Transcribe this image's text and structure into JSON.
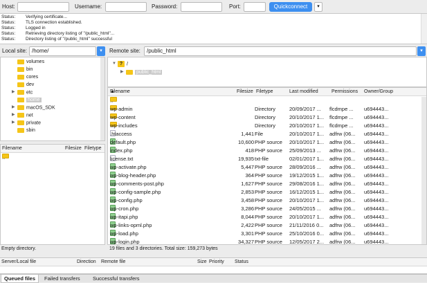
{
  "quickconnect": {
    "host_label": "Host:",
    "username_label": "Username:",
    "password_label": "Password:",
    "port_label": "Port:",
    "connect_label": "Quickconnect",
    "dropdown_glyph": "▾"
  },
  "log": [
    {
      "k": "Status:",
      "v": "Verifying certificate..."
    },
    {
      "k": "Status:",
      "v": "TLS connection established."
    },
    {
      "k": "Status:",
      "v": "Logged in"
    },
    {
      "k": "Status:",
      "v": "Retrieving directory listing of \"/public_html\"..."
    },
    {
      "k": "Status:",
      "v": "Directory listing of \"/public_html\" successful"
    }
  ],
  "local_site": {
    "label": "Local site:",
    "value": "/home/"
  },
  "remote_site": {
    "label": "Remote site:",
    "value": "/public_html"
  },
  "local_tree": [
    {
      "name": "volumes",
      "arrow": ""
    },
    {
      "name": "bin",
      "arrow": ""
    },
    {
      "name": "cores",
      "arrow": ""
    },
    {
      "name": "dev",
      "arrow": ""
    },
    {
      "name": "etc",
      "arrow": "▶"
    },
    {
      "name": "home",
      "arrow": "",
      "selected": true
    },
    {
      "name": "macOS_SDK",
      "arrow": "▶"
    },
    {
      "name": "net",
      "arrow": "▶"
    },
    {
      "name": "private",
      "arrow": "▶"
    },
    {
      "name": "sbin",
      "arrow": ""
    }
  ],
  "remote_tree": [
    {
      "name": "/",
      "arrow": "▼",
      "unknown": true
    },
    {
      "name": "public_html",
      "arrow": "▶",
      "selected": true
    }
  ],
  "local_list": {
    "headers": [
      "Filename",
      "Filesize",
      "Filetype"
    ],
    "rows": [
      {
        "name": ".."
      }
    ],
    "status": "Empty directory."
  },
  "remote_list": {
    "headers": [
      "Filename",
      "Filesize",
      "Filetype",
      "Last modified",
      "Permissions",
      "Owner/Group"
    ],
    "sort_glyph": "▲",
    "rows": [
      {
        "name": "..",
        "size": "",
        "type": "",
        "modified": "",
        "perms": "",
        "owner": "",
        "icon": "fold"
      },
      {
        "name": "wp-admin",
        "size": "",
        "type": "Directory",
        "modified": "20/09/2017 ...",
        "perms": "flcdmpe ...",
        "owner": "u694443...",
        "icon": "fold"
      },
      {
        "name": "wp-content",
        "size": "",
        "type": "Directory",
        "modified": "20/10/2017 1...",
        "perms": "flcdmpe ...",
        "owner": "u694443...",
        "icon": "fold"
      },
      {
        "name": "wp-includes",
        "size": "",
        "type": "Directory",
        "modified": "20/10/2017 1...",
        "perms": "flcdmpe ...",
        "owner": "u694443...",
        "icon": "fold"
      },
      {
        "name": ".htaccess",
        "size": "1,441",
        "type": "File",
        "modified": "20/10/2017 1...",
        "perms": "adfrw (06...",
        "owner": "u694443...",
        "icon": "txt"
      },
      {
        "name": "default.php",
        "size": "10,600",
        "type": "PHP source",
        "modified": "20/10/2017 1...",
        "perms": "adfrw (06...",
        "owner": "u694443...",
        "icon": "php"
      },
      {
        "name": "index.php",
        "size": "418",
        "type": "PHP source",
        "modified": "25/09/2013 ...",
        "perms": "adfrw (06...",
        "owner": "u694443...",
        "icon": "php"
      },
      {
        "name": "license.txt",
        "size": "19,935",
        "type": "txt-file",
        "modified": "02/01/2017 1...",
        "perms": "adfrw (06...",
        "owner": "u694443...",
        "icon": "txt"
      },
      {
        "name": "wp-activate.php",
        "size": "5,447",
        "type": "PHP source",
        "modified": "28/09/2016 ...",
        "perms": "adfrw (06...",
        "owner": "u694443...",
        "icon": "php"
      },
      {
        "name": "wp-blog-header.php",
        "size": "364",
        "type": "PHP source",
        "modified": "19/12/2015 1...",
        "perms": "adfrw (06...",
        "owner": "u694443...",
        "icon": "php"
      },
      {
        "name": "wp-comments-post.php",
        "size": "1,627",
        "type": "PHP source",
        "modified": "29/08/2016 1...",
        "perms": "adfrw (06...",
        "owner": "u694443...",
        "icon": "php"
      },
      {
        "name": "wp-config-sample.php",
        "size": "2,853",
        "type": "PHP source",
        "modified": "16/12/2015 1...",
        "perms": "adfrw (06...",
        "owner": "u694443...",
        "icon": "php"
      },
      {
        "name": "wp-config.php",
        "size": "3,458",
        "type": "PHP source",
        "modified": "20/10/2017 1...",
        "perms": "adfrw (06...",
        "owner": "u694443...",
        "icon": "php"
      },
      {
        "name": "wp-cron.php",
        "size": "3,286",
        "type": "PHP source",
        "modified": "24/05/2015 ...",
        "perms": "adfrw (06...",
        "owner": "u694443...",
        "icon": "php"
      },
      {
        "name": "wp-itapi.php",
        "size": "8,044",
        "type": "PHP source",
        "modified": "20/10/2017 1...",
        "perms": "adfrw (06...",
        "owner": "u694443...",
        "icon": "php"
      },
      {
        "name": "wp-links-opml.php",
        "size": "2,422",
        "type": "PHP source",
        "modified": "21/11/2016 0...",
        "perms": "adfrw (06...",
        "owner": "u694443...",
        "icon": "php"
      },
      {
        "name": "wp-load.php",
        "size": "3,301",
        "type": "PHP source",
        "modified": "25/10/2016 0...",
        "perms": "adfrw (06...",
        "owner": "u694443...",
        "icon": "php"
      },
      {
        "name": "wp-login.php",
        "size": "34,327",
        "type": "PHP source",
        "modified": "12/05/2017 2...",
        "perms": "adfrw (06...",
        "owner": "u694443...",
        "icon": "php"
      }
    ],
    "status": "19 files and 3 directories. Total size: 159,273 bytes"
  },
  "queue": {
    "headers": [
      "Server/Local file",
      "Direction",
      "Remote file",
      "Size",
      "Priority",
      "Status"
    ]
  },
  "tabs": [
    "Queued files",
    "Failed transfers",
    "Successful transfers"
  ]
}
